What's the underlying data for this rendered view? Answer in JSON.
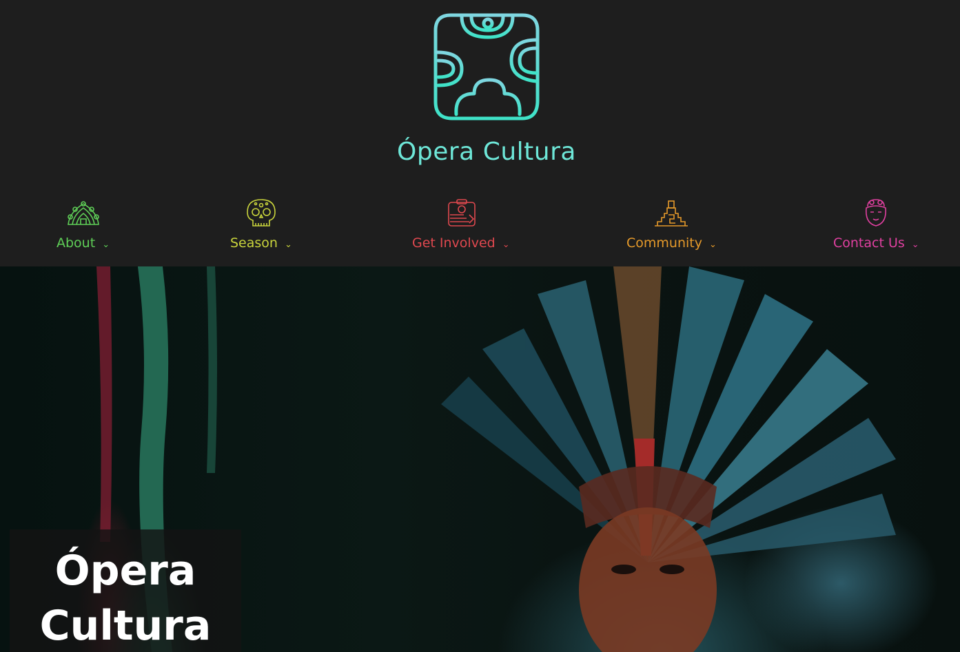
{
  "brand": {
    "name": "Ópera Cultura",
    "logo_icon": "mayan-glyph-icon",
    "logo_color": "#6ee7d8"
  },
  "nav": [
    {
      "label": "About",
      "caret": "⌄",
      "icon": "peacock-feathers-icon",
      "color": "#5fcf57"
    },
    {
      "label": "Season",
      "caret": "⌄",
      "icon": "sugar-skull-icon",
      "color": "#c9d43c"
    },
    {
      "label": "Get Involved",
      "caret": "⌄",
      "icon": "glyph-box-icon",
      "color": "#e0484f"
    },
    {
      "label": "Community",
      "caret": "⌄",
      "icon": "pyramid-icon",
      "color": "#e69a2a"
    },
    {
      "label": "Contact Us",
      "caret": "⌄",
      "icon": "face-portrait-icon",
      "color": "#e040a0"
    }
  ],
  "hero": {
    "title_line1": "Ópera",
    "title_line2": "Cultura",
    "image": "performer-feather-headdress"
  }
}
